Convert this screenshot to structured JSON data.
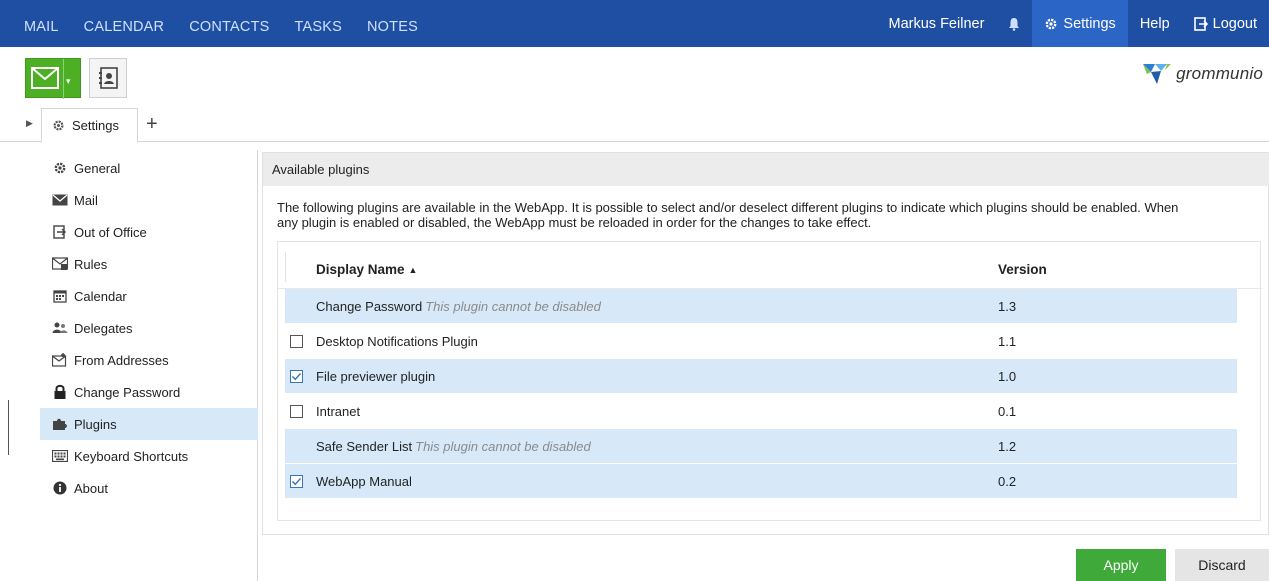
{
  "nav": {
    "left_items": [
      "MAIL",
      "CALENDAR",
      "CONTACTS",
      "TASKS",
      "NOTES"
    ],
    "user_name": "Markus Feilner",
    "settings_label": "Settings",
    "help_label": "Help",
    "logout_label": "Logout"
  },
  "toolbar": {
    "logo_text": "grommunio"
  },
  "tabs": {
    "settings_label": "Settings",
    "add_label": "+"
  },
  "sidebar": {
    "items": [
      {
        "label": "General",
        "icon": "gear-icon"
      },
      {
        "label": "Mail",
        "icon": "envelope-icon"
      },
      {
        "label": "Out of Office",
        "icon": "exit-icon"
      },
      {
        "label": "Rules",
        "icon": "rules-icon"
      },
      {
        "label": "Calendar",
        "icon": "calendar-icon"
      },
      {
        "label": "Delegates",
        "icon": "people-icon"
      },
      {
        "label": "From Addresses",
        "icon": "from-address-icon"
      },
      {
        "label": "Change Password",
        "icon": "lock-icon"
      },
      {
        "label": "Plugins",
        "icon": "puzzle-icon"
      },
      {
        "label": "Keyboard Shortcuts",
        "icon": "keyboard-icon"
      },
      {
        "label": "About",
        "icon": "info-icon"
      }
    ],
    "selected": "Plugins"
  },
  "panel": {
    "title": "Available plugins",
    "description_line1": "The following plugins are available in the WebApp. It is possible to select and/or deselect different plugins to indicate which plugins should be enabled. When",
    "description_line2": "any plugin is enabled or disabled, the WebApp must be reloaded in order for the changes to take effect.",
    "columns": {
      "name": "Display Name",
      "sort_indicator": "▲",
      "version": "Version"
    },
    "rows": [
      {
        "name": "Change Password",
        "note": "This plugin cannot be disabled",
        "version": "1.3",
        "checkbox": "none",
        "shaded": true
      },
      {
        "name": "Desktop Notifications Plugin",
        "note": "",
        "version": "1.1",
        "checkbox": "unchecked",
        "shaded": false
      },
      {
        "name": "File previewer plugin",
        "note": "",
        "version": "1.0",
        "checkbox": "checked",
        "shaded": true
      },
      {
        "name": "Intranet",
        "note": "",
        "version": "0.1",
        "checkbox": "unchecked",
        "shaded": false
      },
      {
        "name": "Safe Sender List",
        "note": "This plugin cannot be disabled",
        "version": "1.2",
        "checkbox": "none",
        "shaded": true
      },
      {
        "name": "WebApp Manual",
        "note": "",
        "version": "0.2",
        "checkbox": "checked",
        "shaded": true
      }
    ]
  },
  "buttons": {
    "apply": "Apply",
    "discard": "Discard"
  },
  "colors": {
    "topbar": "#1f4fa3",
    "accent_green": "#4caf24",
    "selection": "#d7e9f9"
  }
}
